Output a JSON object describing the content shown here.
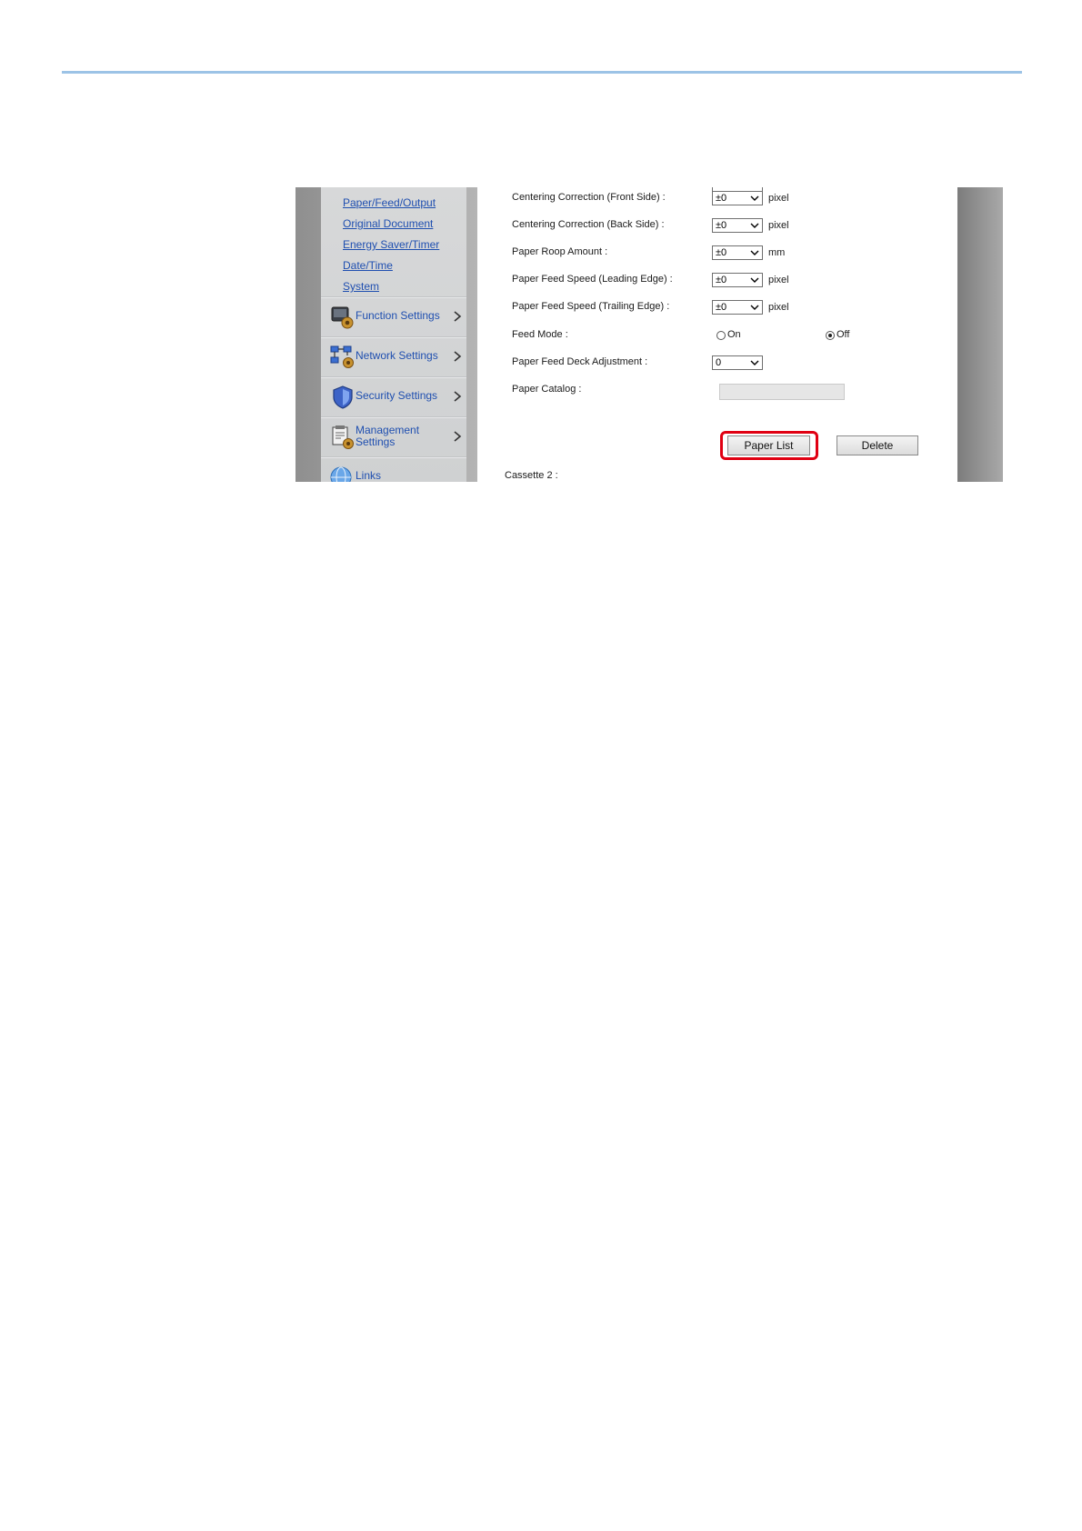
{
  "sidebar": {
    "sub_links": [
      "Paper/Feed/Output",
      "Original Document",
      "Energy Saver/Timer",
      "Date/Time",
      "System"
    ],
    "sections": [
      {
        "label": "Function Settings",
        "icon": "function-settings-icon"
      },
      {
        "label": "Network Settings",
        "icon": "network-settings-icon"
      },
      {
        "label": "Security Settings",
        "icon": "security-shield-icon"
      },
      {
        "label_line1": "Management",
        "label_line2": "Settings",
        "icon": "management-settings-icon"
      },
      {
        "label": "Links",
        "icon": "globe-icon"
      }
    ]
  },
  "form": {
    "rows": [
      {
        "label": "Centering Correction (Front Side) :",
        "value": "±0",
        "unit": "pixel"
      },
      {
        "label": "Centering Correction (Back Side) :",
        "value": "±0",
        "unit": "pixel"
      },
      {
        "label": "Paper Roop Amount :",
        "value": "±0",
        "unit": "mm"
      },
      {
        "label": "Paper Feed Speed (Leading Edge) :",
        "value": "±0",
        "unit": "pixel"
      },
      {
        "label": "Paper Feed Speed (Trailing Edge) :",
        "value": "±0",
        "unit": "pixel"
      }
    ],
    "feed_mode": {
      "label": "Feed Mode :",
      "option_on": "On",
      "option_off": "Off",
      "selected": "Off"
    },
    "deck_adjustment": {
      "label": "Paper Feed Deck Adjustment :",
      "value": "0"
    },
    "paper_catalog": {
      "label": "Paper Catalog :",
      "value": ""
    },
    "buttons": {
      "paper_list": "Paper List",
      "delete": "Delete"
    },
    "next_section": "Cassette 2 :"
  },
  "colors": {
    "highlight": "#e00012",
    "link": "#1f4fb0",
    "rule": "#9cc3e6"
  }
}
